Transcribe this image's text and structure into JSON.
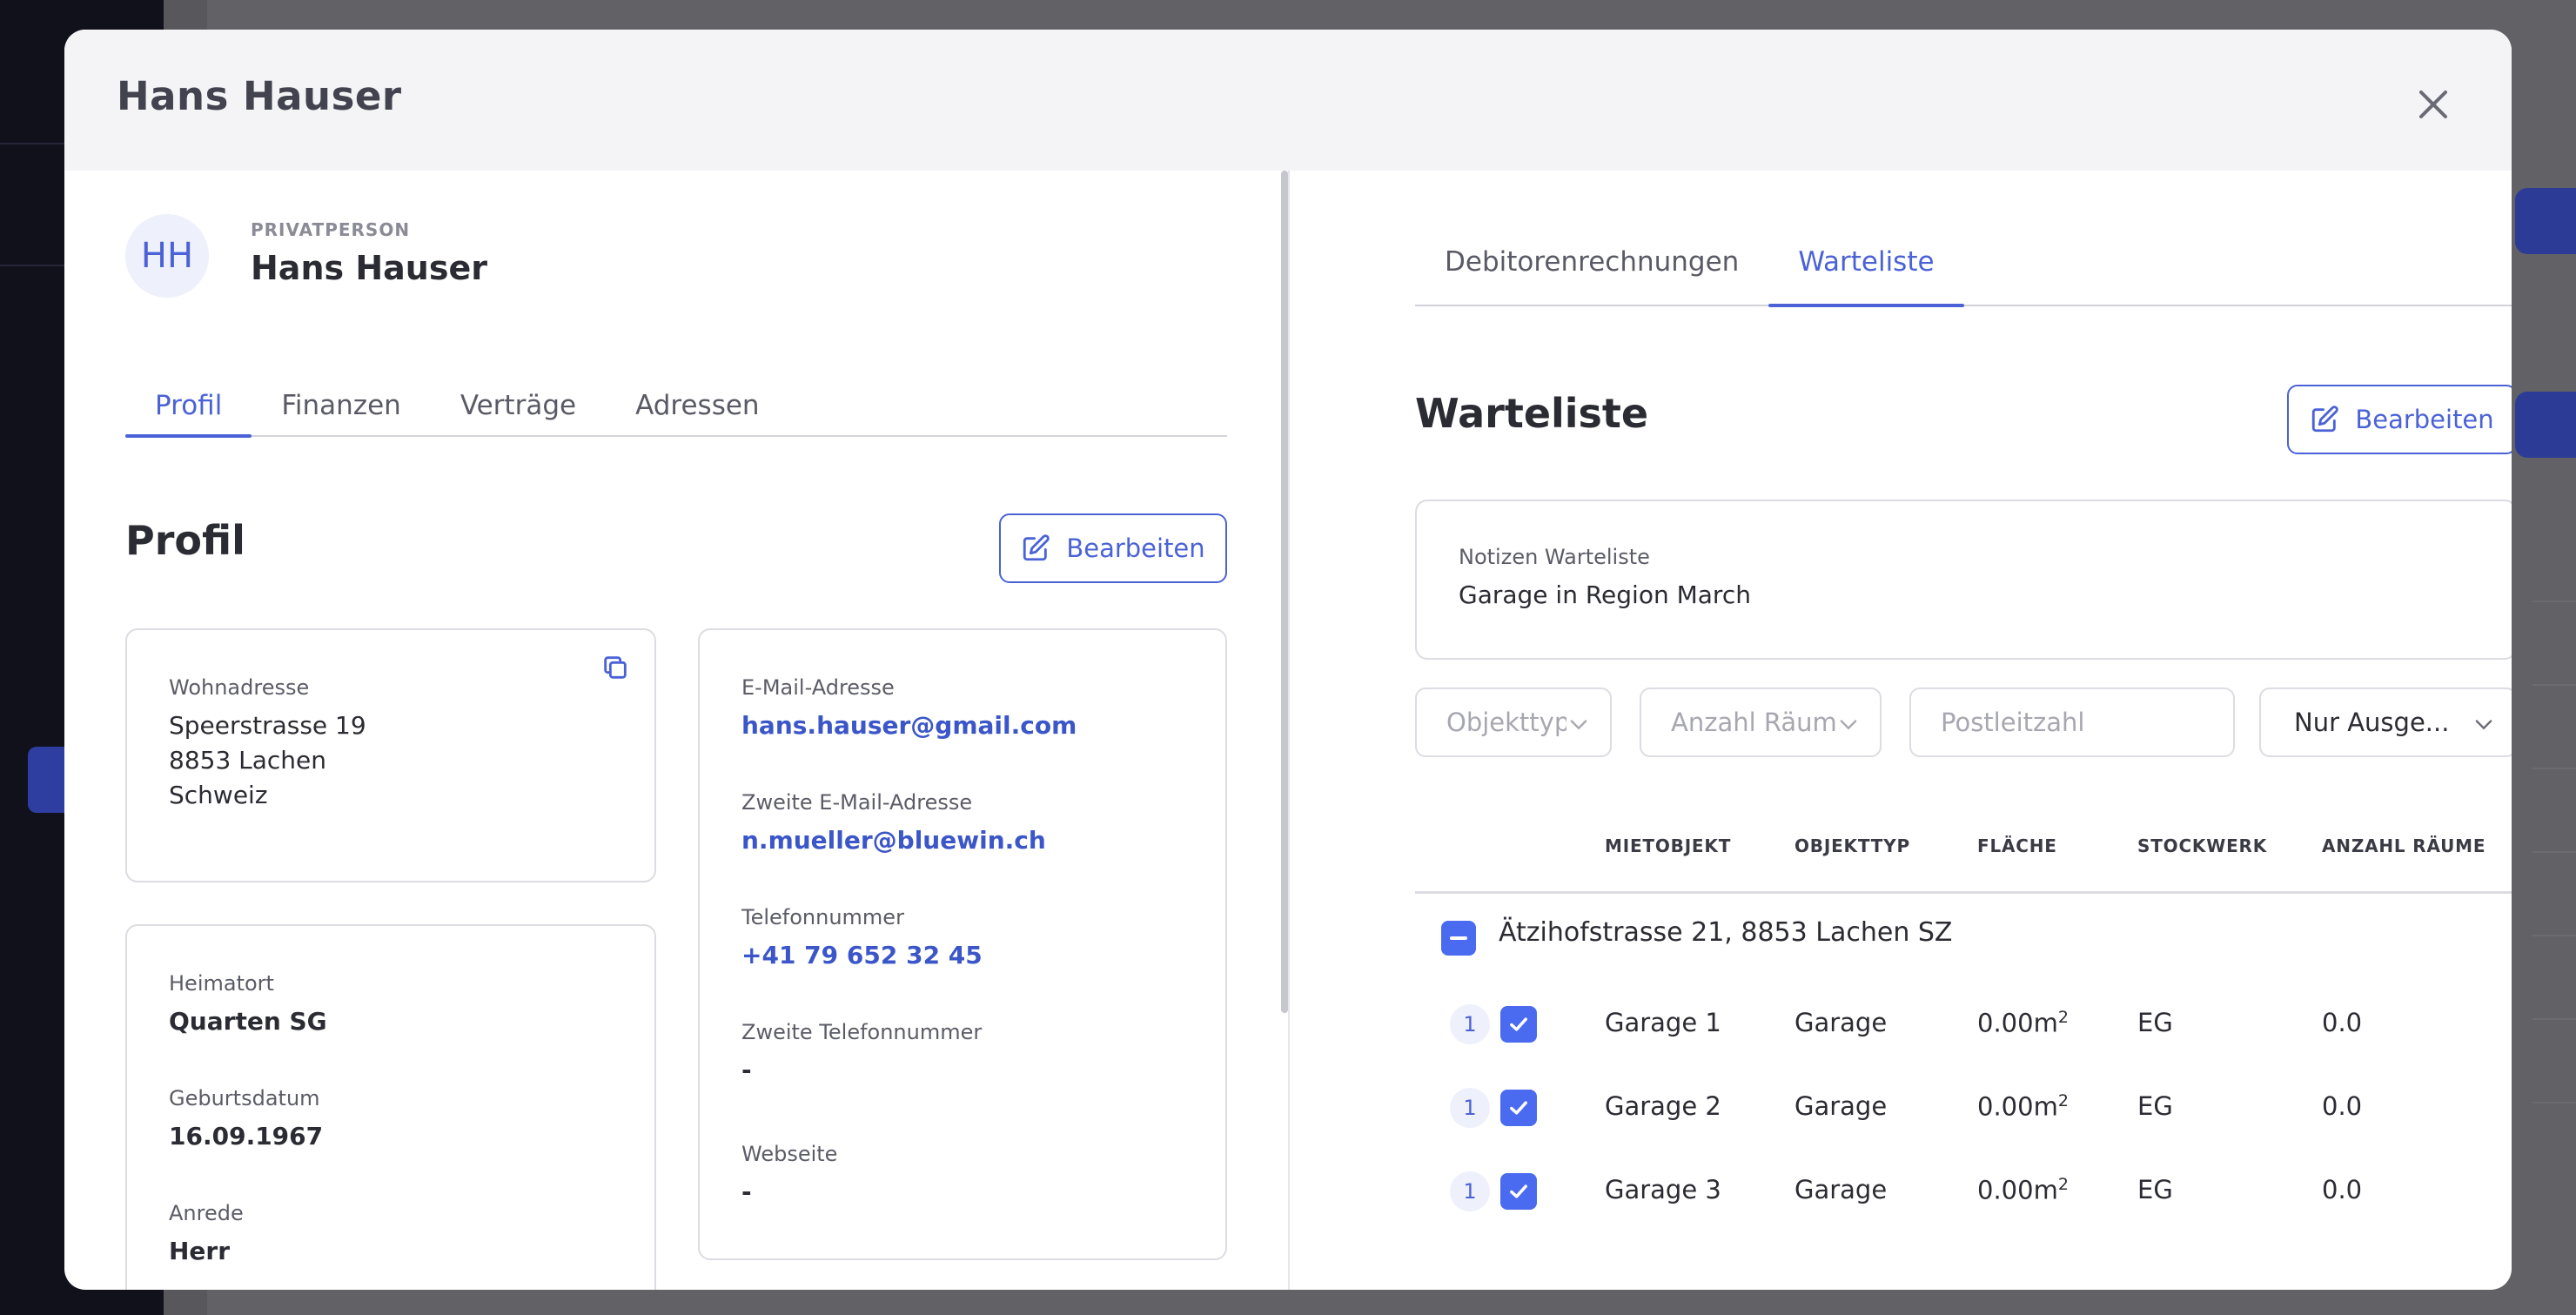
{
  "modal": {
    "title": "Hans Hauser"
  },
  "person": {
    "initials": "HH",
    "type": "PRIVATPERSON",
    "name": "Hans Hauser"
  },
  "left_tabs": [
    {
      "label": "Profil",
      "active": true
    },
    {
      "label": "Finanzen",
      "active": false
    },
    {
      "label": "Verträge",
      "active": false
    },
    {
      "label": "Adressen",
      "active": false
    }
  ],
  "profile": {
    "title": "Profil",
    "edit_label": "Bearbeiten",
    "address": {
      "label": "Wohnadresse",
      "line1": "Speerstrasse 19",
      "line2": "8853 Lachen",
      "line3": "Schweiz"
    },
    "heimatort": {
      "label": "Heimatort",
      "value": "Quarten SG"
    },
    "geburtsdatum": {
      "label": "Geburtsdatum",
      "value": "16.09.1967"
    },
    "anrede": {
      "label": "Anrede",
      "value": "Herr"
    },
    "email": {
      "label": "E-Mail-Adresse",
      "value": "hans.hauser@gmail.com"
    },
    "email2": {
      "label": "Zweite E-Mail-Adresse",
      "value": "n.mueller@bluewin.ch"
    },
    "phone": {
      "label": "Telefonnummer",
      "value": "+41 79 652 32 45"
    },
    "phone2": {
      "label": "Zweite Telefonnummer",
      "value": "-"
    },
    "website": {
      "label": "Webseite",
      "value": "-"
    }
  },
  "right_tabs": [
    {
      "label": "Debitorenrechnungen",
      "active": false
    },
    {
      "label": "Warteliste",
      "active": true
    }
  ],
  "waitlist": {
    "title": "Warteliste",
    "edit_label": "Bearbeiten",
    "notes_label": "Notizen Warteliste",
    "notes_value": "Garage in Region March",
    "filters": {
      "objekttyp": "Objekttyp",
      "anzahl_raeume": "Anzahl Räume",
      "postleitzahl": "Postleitzahl",
      "nur": "Nur Ausge..."
    },
    "columns": [
      "MIETOBJEKT",
      "OBJEKTTYP",
      "FLÄCHE",
      "STOCKWERK",
      "ANZAHL RÄUME"
    ],
    "group": "Ätzihofstrasse 21, 8853 Lachen SZ",
    "rows": [
      {
        "num": "1",
        "name": "Garage 1",
        "type": "Garage",
        "area": "0.00m",
        "area_unit_exp": "2",
        "floor": "EG",
        "rooms": "0.0",
        "checked": true
      },
      {
        "num": "1",
        "name": "Garage 2",
        "type": "Garage",
        "area": "0.00m",
        "area_unit_exp": "2",
        "floor": "EG",
        "rooms": "0.0",
        "checked": true
      },
      {
        "num": "1",
        "name": "Garage 3",
        "type": "Garage",
        "area": "0.00m",
        "area_unit_exp": "2",
        "floor": "EG",
        "rooms": "0.0",
        "checked": true
      }
    ]
  }
}
